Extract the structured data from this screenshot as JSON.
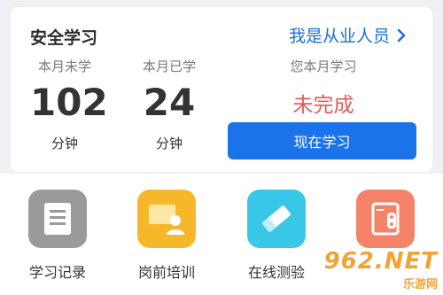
{
  "card": {
    "title": "安全学习",
    "practitioner_link": "我是从业人员",
    "stats": [
      {
        "label": "本月未学",
        "value": "102",
        "unit": "分钟"
      },
      {
        "label": "本月已学",
        "value": "24",
        "unit": "分钟"
      }
    ],
    "status": {
      "label": "您本月学习",
      "value": "未完成"
    },
    "study_button": "现在学习"
  },
  "tiles": [
    {
      "label": "学习记录",
      "color": "#9a9a9a",
      "icon": "document-icon"
    },
    {
      "label": "岗前培训",
      "color": "#f7b72a",
      "icon": "trainer-board-icon"
    },
    {
      "label": "在线测验",
      "color": "#38c7e6",
      "icon": "eraser-icon"
    },
    {
      "label": "",
      "color": "#f5836a",
      "icon": "safe-box-icon"
    }
  ],
  "watermark": {
    "big": "962.NET",
    "small": "乐游网"
  },
  "colors": {
    "accent": "#1a73e8",
    "warning": "#e05a5a"
  }
}
